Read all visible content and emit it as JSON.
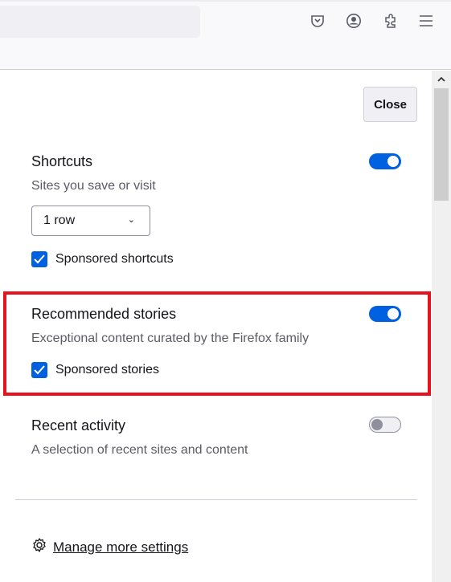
{
  "toolbar": {
    "icons": [
      "pocket-icon",
      "account-icon",
      "extensions-icon",
      "menu-icon"
    ]
  },
  "panel": {
    "close_label": "Close",
    "shortcuts": {
      "title": "Shortcuts",
      "description": "Sites you save or visit",
      "enabled": true,
      "rows_value": "1 row",
      "sponsored_label": "Sponsored shortcuts",
      "sponsored_checked": true
    },
    "stories": {
      "title": "Recommended stories",
      "description": "Exceptional content curated by the Firefox family",
      "enabled": true,
      "sponsored_label": "Sponsored stories",
      "sponsored_checked": true
    },
    "recent": {
      "title": "Recent activity",
      "description": "A selection of recent sites and content",
      "enabled": false
    },
    "manage_label": "Manage more settings"
  },
  "colors": {
    "accent": "#0061e0",
    "highlight": "#e8121e"
  }
}
